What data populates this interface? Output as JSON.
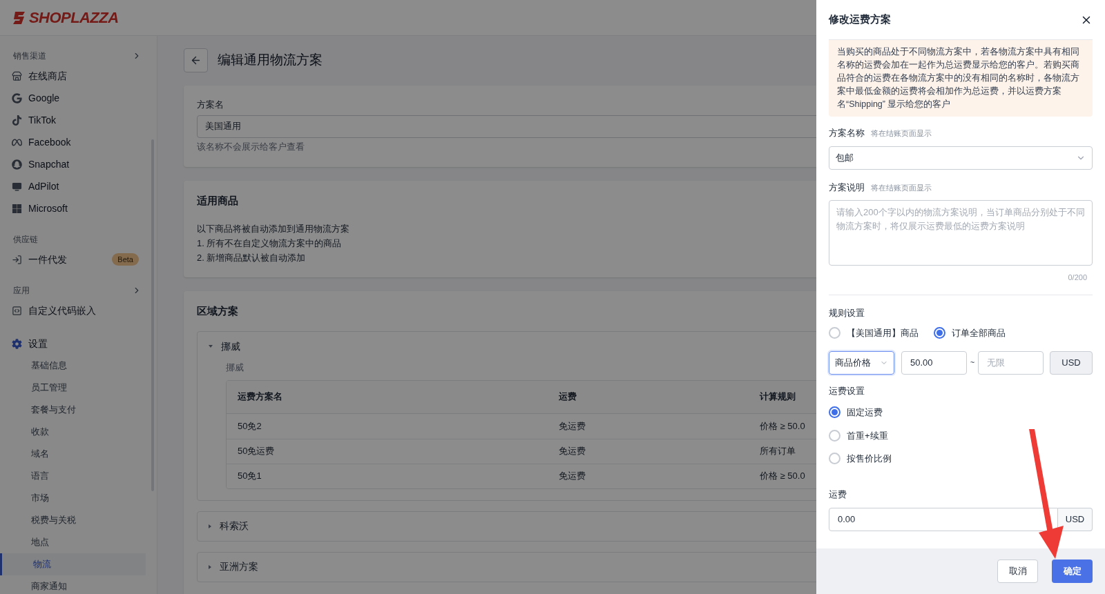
{
  "logo": {
    "text": "SHOPLAZZA"
  },
  "sidebar": {
    "sections": [
      {
        "title": "销售渠道",
        "expandable": true,
        "items": [
          {
            "label": "在线商店"
          },
          {
            "label": "Google"
          },
          {
            "label": "TikTok"
          },
          {
            "label": "Facebook"
          },
          {
            "label": "Snapchat"
          },
          {
            "label": "AdPilot"
          },
          {
            "label": "Microsoft"
          }
        ]
      },
      {
        "title": "供应链",
        "expandable": false,
        "items": [
          {
            "label": "一件代发",
            "badge": "Beta"
          }
        ]
      },
      {
        "title": "应用",
        "expandable": true,
        "items": [
          {
            "label": "自定义代码嵌入"
          }
        ]
      },
      {
        "items": [
          {
            "label": "设置",
            "children": [
              {
                "label": "基础信息",
                "selected": false
              },
              {
                "label": "员工管理",
                "selected": false
              },
              {
                "label": "套餐与支付",
                "selected": false
              },
              {
                "label": "收款",
                "selected": false
              },
              {
                "label": "域名",
                "selected": false
              },
              {
                "label": "语言",
                "selected": false
              },
              {
                "label": "市场",
                "selected": false
              },
              {
                "label": "税费与关税",
                "selected": false
              },
              {
                "label": "地点",
                "selected": false
              },
              {
                "label": "物流",
                "selected": true
              },
              {
                "label": "商家通知",
                "selected": false
              }
            ]
          }
        ]
      }
    ]
  },
  "page": {
    "title": "编辑通用物流方案",
    "name_card": {
      "label": "方案名",
      "value": "美国通用",
      "hint": "该名称不会展示给客户查看"
    },
    "products_card": {
      "title": "适用商品",
      "lines": [
        "以下商品将被自动添加到通用物流方案",
        "1. 所有不在自定义物流方案中的商品",
        "2. 新增商品默认被自动添加"
      ]
    },
    "zones_card": {
      "title": "区域方案",
      "zones": [
        {
          "name": "挪威",
          "expanded": true,
          "subtitle": "挪威",
          "table": {
            "columns": [
              "运费方案名",
              "运费",
              "计算规则"
            ],
            "rows": [
              {
                "cells": [
                  "50免2",
                  "免运费",
                  "价格 ≥ 50.0"
                ]
              },
              {
                "cells": [
                  "50免运费",
                  "免运费",
                  "所有订单"
                ]
              },
              {
                "cells": [
                  "50免1",
                  "免运费",
                  "价格 ≥ 50.0"
                ]
              }
            ]
          }
        },
        {
          "name": "科索沃",
          "expanded": false
        },
        {
          "name": "亚洲方案",
          "expanded": false
        }
      ]
    }
  },
  "drawer": {
    "title": "修改运费方案",
    "notice": "当购买的商品处于不同物流方案中，若各物流方案中具有相同名称的运费会加在一起作为总运费显示给您的客户。若购买商品符合的运费在各物流方案中的没有相同的名称时，各物流方案中最低金额的运费将会相加作为总运费，并以运费方案名“Shipping” 显示给您的客户",
    "name_field": {
      "label": "方案名称",
      "hint": "将在结账页面显示",
      "value": "包邮"
    },
    "description_field": {
      "label": "方案说明",
      "hint": "将在结账页面显示",
      "placeholder": "请输入200个字以内的物流方案说明，当订单商品分别处于不同物流方案时，将仅展示运费最低的运费方案说明",
      "counter": "0/200"
    },
    "rule_settings": {
      "label": "规则设置",
      "options": [
        {
          "label": "【美国通用】商品",
          "selected": false
        },
        {
          "label": "订单全部商品",
          "selected": true
        }
      ],
      "condition": {
        "type": "商品价格",
        "min": "50.00",
        "separator": "~",
        "max_placeholder": "无限",
        "currency": "USD"
      }
    },
    "fee_settings": {
      "label": "运费设置",
      "options": [
        {
          "label": "固定运费",
          "selected": true
        },
        {
          "label": "首重+续重",
          "selected": false
        },
        {
          "label": "按售价比例",
          "selected": false
        }
      ]
    },
    "fee": {
      "label": "运费",
      "value": "0.00",
      "currency": "USD"
    },
    "buttons": {
      "cancel": "取消",
      "confirm": "确定"
    }
  }
}
